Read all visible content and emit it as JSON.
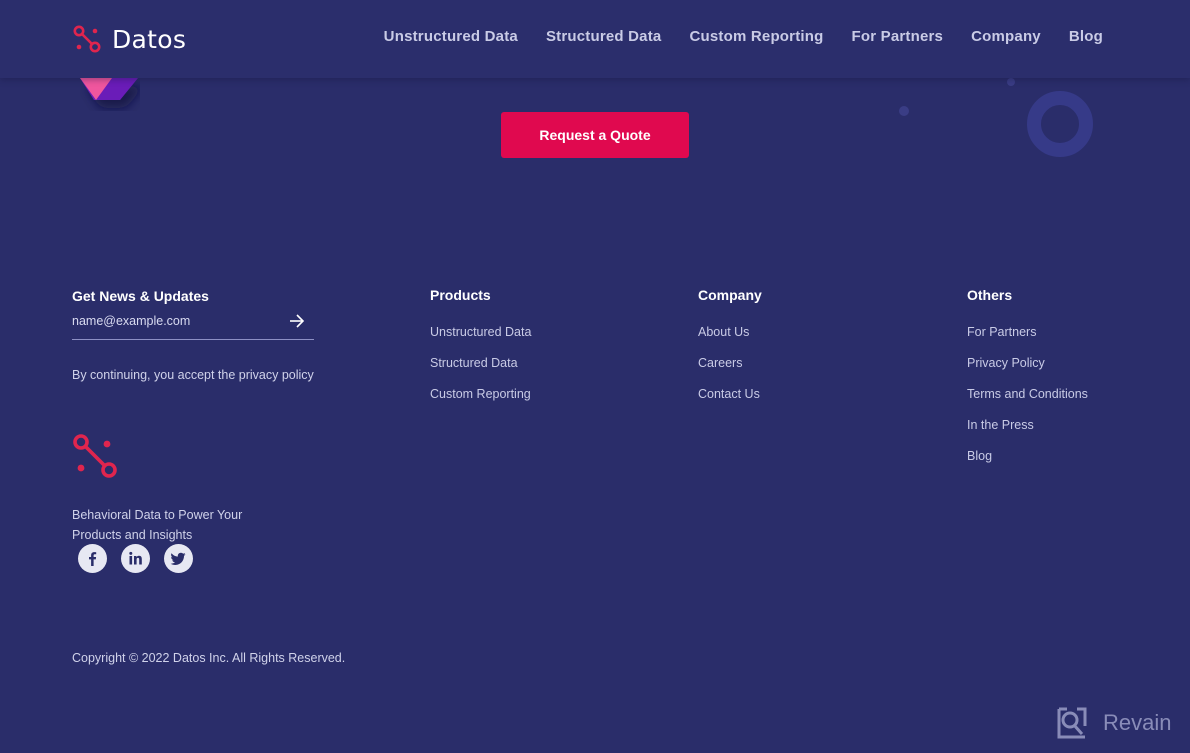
{
  "header": {
    "brand": "Datos",
    "nav": [
      {
        "label": "Unstructured Data"
      },
      {
        "label": "Structured Data"
      },
      {
        "label": "Custom Reporting"
      },
      {
        "label": "For Partners"
      },
      {
        "label": "Company"
      },
      {
        "label": "Blog"
      }
    ]
  },
  "cta": {
    "label": "Request a Quote",
    "color": "#e0094f"
  },
  "newsletter": {
    "title": "Get News & Updates",
    "email_placeholder": "name@example.com",
    "submit_icon": "arrow-right-icon",
    "note": "By continuing, you accept the privacy policy"
  },
  "brand_block": {
    "icon": "datos-logo-icon",
    "tagline": "Behavioral Data to Power Your Products and Insights",
    "socials": [
      {
        "name": "facebook",
        "icon": "facebook-icon"
      },
      {
        "name": "linkedin",
        "icon": "linkedin-icon"
      },
      {
        "name": "twitter",
        "icon": "twitter-icon"
      }
    ]
  },
  "columns": {
    "products": {
      "title": "Products",
      "links": [
        "Unstructured Data",
        "Structured Data",
        "Custom Reporting"
      ]
    },
    "company": {
      "title": "Company",
      "links": [
        "About Us",
        "Careers",
        "Contact Us"
      ]
    },
    "others": {
      "title": "Others",
      "links": [
        "For Partners",
        "Privacy Policy",
        "Terms and Conditions",
        "In the Press",
        "Blog"
      ]
    }
  },
  "copyright": "Copyright © 2022 Datos Inc. All Rights Reserved.",
  "watermark": {
    "label": "Revain",
    "icon": "revain-logo-icon"
  },
  "colors": {
    "background": "#2a2d6a",
    "accent": "#e0094f",
    "logo_red": "#e0254e"
  }
}
